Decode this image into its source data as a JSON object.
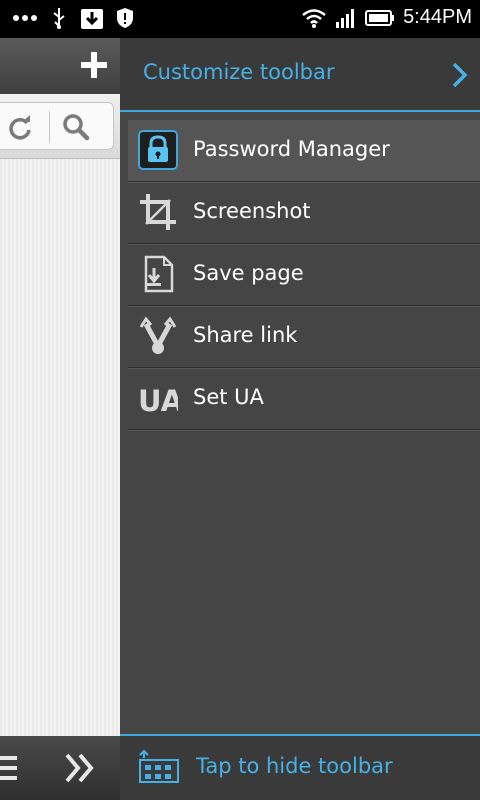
{
  "status_bar": {
    "time": "5:44PM",
    "icons": [
      "more-dots-icon",
      "usb-icon",
      "download-icon",
      "shield-icon",
      "wifi-icon",
      "signal-icon",
      "battery-icon"
    ]
  },
  "panel": {
    "header_title": "Customize toolbar",
    "items": [
      {
        "label": "Password Manager",
        "icon": "lock-icon",
        "active": true
      },
      {
        "label": "Screenshot",
        "icon": "crop-icon",
        "active": false
      },
      {
        "label": "Save page",
        "icon": "save-page-icon",
        "active": false
      },
      {
        "label": "Share link",
        "icon": "share-icon",
        "active": false
      },
      {
        "label": "Set UA",
        "icon": "ua-icon",
        "active": false
      }
    ],
    "ua_glyph": "UA",
    "footer_label": "Tap to hide toolbar"
  },
  "colors": {
    "accent": "#46b1e6",
    "panel_bg": "#454545",
    "header_bg": "#3a3a3a"
  }
}
